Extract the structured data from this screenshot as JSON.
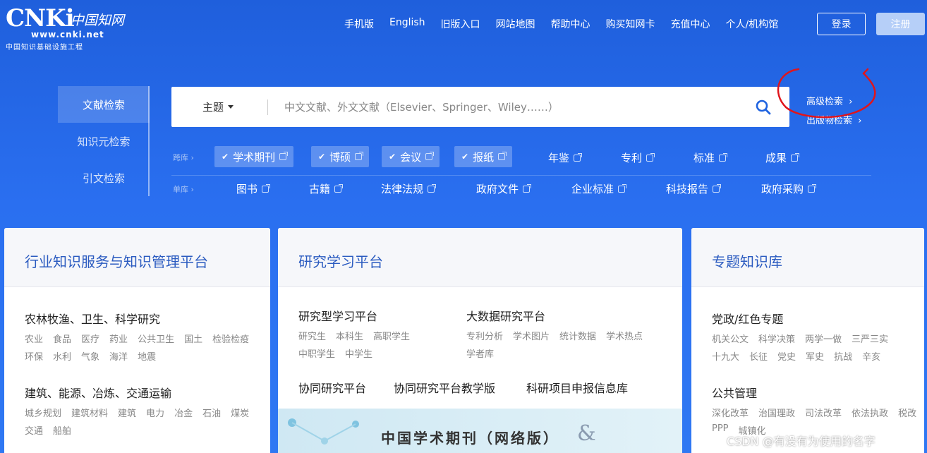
{
  "header": {
    "logo": {
      "mark": "CNKi",
      "cn": "中国知网",
      "url": "www.cnki.net",
      "subtitle": "中国知识基础设施工程"
    },
    "nav": [
      "手机版",
      "English",
      "旧版入口",
      "网站地图",
      "帮助中心",
      "购买知网卡",
      "充值中心",
      "个人/机构馆"
    ],
    "login": "登录",
    "register": "注册"
  },
  "search": {
    "tabs": [
      "文献检索",
      "知识元检索",
      "引文检索"
    ],
    "scope": "主题",
    "placeholder": "中文文献、外文文献（Elsevier、Springer、Wiley……）",
    "advanced": "高级检索",
    "publication": "出版物检索",
    "cross_label": "跨库",
    "single_label": "单库",
    "cross_libs": [
      {
        "label": "学术期刊",
        "checked": true
      },
      {
        "label": "博硕",
        "checked": true
      },
      {
        "label": "会议",
        "checked": true
      },
      {
        "label": "报纸",
        "checked": true
      },
      {
        "label": "年鉴",
        "checked": false
      },
      {
        "label": "专利",
        "checked": false
      },
      {
        "label": "标准",
        "checked": false
      },
      {
        "label": "成果",
        "checked": false
      }
    ],
    "single_libs": [
      "图书",
      "古籍",
      "法律法规",
      "政府文件",
      "企业标准",
      "科技报告",
      "政府采购"
    ]
  },
  "cards": {
    "industry": {
      "title": "行业知识服务与知识管理平台",
      "sections": [
        {
          "title": "农林牧渔、卫生、科学研究",
          "items": [
            "农业",
            "食品",
            "医疗",
            "药业",
            "公共卫生",
            "国土",
            "检验检疫",
            "环保",
            "水利",
            "气象",
            "海洋",
            "地震"
          ]
        },
        {
          "title": "建筑、能源、冶炼、交通运输",
          "items": [
            "城乡规划",
            "建筑材料",
            "建筑",
            "电力",
            "冶金",
            "石油",
            "煤炭",
            "交通",
            "船舶"
          ]
        }
      ]
    },
    "research": {
      "title": "研究学习平台",
      "study_title": "研究型学习平台",
      "study_items": [
        "研究生",
        "本科生",
        "高职学生",
        "中职学生",
        "中学生"
      ],
      "bigdata_title": "大数据研究平台",
      "bigdata_items": [
        "专利分析",
        "学术图片",
        "统计数据",
        "学术热点",
        "学者库"
      ],
      "links": [
        "协同研究平台",
        "协同研究平台教学版",
        "科研项目申报信息库"
      ],
      "promo": "中国学术期刊（网络版）",
      "promo_amp": "&"
    },
    "topic": {
      "title": "专题知识库",
      "sections": [
        {
          "title": "党政/红色专题",
          "items": [
            "机关公文",
            "科学决策",
            "两学一做",
            "三严三实",
            "十九大",
            "长征",
            "党史",
            "军史",
            "抗战",
            "辛亥"
          ]
        },
        {
          "title": "公共管理",
          "items": [
            "深化改革",
            "治国理政",
            "司法改革",
            "依法执政",
            "税改",
            "PPP",
            "城镇化"
          ]
        }
      ]
    }
  },
  "watermark": "CSDN @有没有为使用的名字",
  "colors": {
    "accent": "#2a6ff0",
    "title_blue": "#2b5bc0",
    "annotation": "#e0151c"
  }
}
